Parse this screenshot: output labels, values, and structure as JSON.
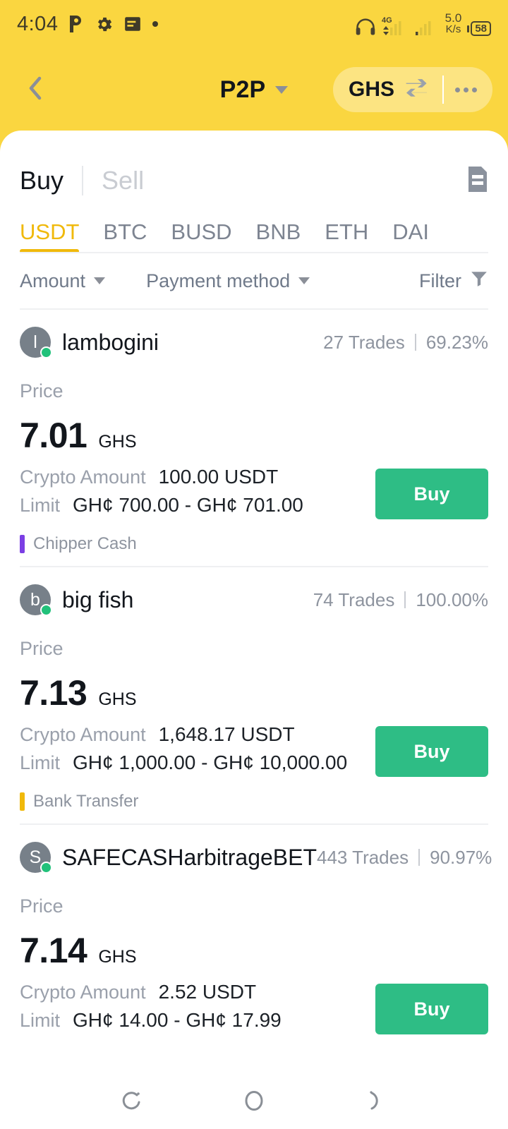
{
  "status_bar": {
    "time": "4:04",
    "icons_left": [
      "p-app-icon",
      "gear-icon",
      "list-icon",
      "dot-icon"
    ],
    "icons_right": [
      "headphones-icon",
      "4g-signal-icon",
      "signal-icon"
    ],
    "network_speed_value": "5.0",
    "network_speed_unit": "K/s",
    "battery_level": "58"
  },
  "header": {
    "back_icon": "chevron-left-icon",
    "title": "P2P",
    "title_caret_icon": "chevron-down-icon",
    "currency": "GHS",
    "swap_icon": "swap-arrows-icon",
    "more_icon": "more-options-icon"
  },
  "mode_tabs": {
    "buy_label": "Buy",
    "sell_label": "Sell",
    "active": "Buy",
    "order_history_icon": "document-icon"
  },
  "coin_tabs": {
    "items": [
      {
        "label": "USDT"
      },
      {
        "label": "BTC"
      },
      {
        "label": "BUSD"
      },
      {
        "label": "BNB"
      },
      {
        "label": "ETH"
      },
      {
        "label": "DAI"
      }
    ],
    "active_index": 0
  },
  "filters": {
    "amount_label": "Amount",
    "payment_method_label": "Payment method",
    "filter_label": "Filter",
    "filter_icon": "funnel-icon"
  },
  "labels": {
    "price": "Price",
    "crypto_amount": "Crypto Amount",
    "limit": "Limit",
    "trades_suffix": "Trades",
    "buy_button": "Buy"
  },
  "colors": {
    "header_yellow": "#FAD640",
    "accent_yellow": "#F0B90B",
    "buy_green": "#2EBD85",
    "online_green": "#21C17A",
    "chipper_purple": "#7B3FE4",
    "bank_yellow": "#F0B90B",
    "muted_text": "#9aa0ab"
  },
  "offers": [
    {
      "avatar_letter": "l",
      "merchant": "lambogini",
      "trades": "27 Trades",
      "completion": "69.23%",
      "price": "7.01",
      "currency": "GHS",
      "crypto_amount": "100.00 USDT",
      "limit": "GH¢ 700.00 - GH¢ 701.00",
      "payment_method": "Chipper Cash",
      "payment_color": "#7B3FE4"
    },
    {
      "avatar_letter": "b",
      "merchant": "big fish",
      "trades": "74 Trades",
      "completion": "100.00%",
      "price": "7.13",
      "currency": "GHS",
      "crypto_amount": "1,648.17 USDT",
      "limit": "GH¢ 1,000.00 - GH¢ 10,000.00",
      "payment_method": "Bank Transfer",
      "payment_color": "#F0B90B"
    },
    {
      "avatar_letter": "S",
      "merchant": "SAFECASHarbitrageBET",
      "trades": "443 Trades",
      "completion": "90.97%",
      "price": "7.14",
      "currency": "GHS",
      "crypto_amount": "2.52 USDT",
      "limit": "GH¢ 14.00 - GH¢ 17.99",
      "payment_method": "",
      "payment_color": ""
    }
  ],
  "nav_bar": {
    "recents_icon": "recents-icon",
    "home_icon": "home-circle-icon",
    "back_icon": "back-icon"
  }
}
